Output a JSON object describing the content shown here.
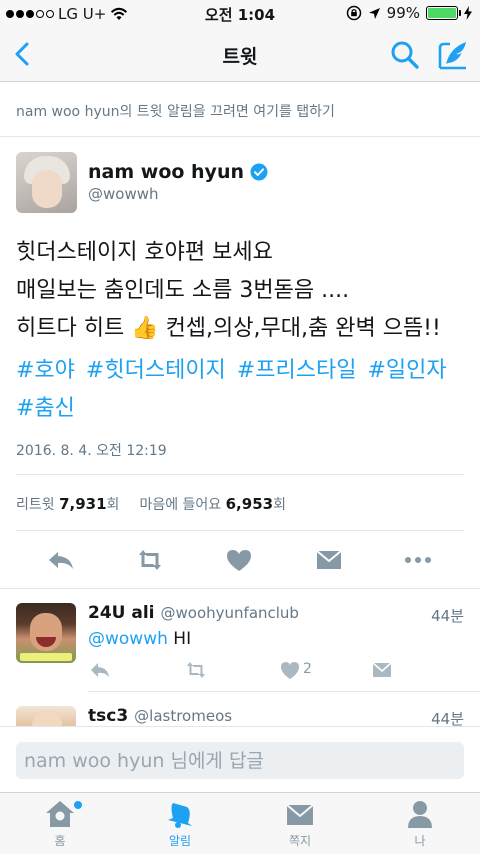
{
  "status_bar": {
    "carrier": "LG U+",
    "time": "오전 1:04",
    "battery": "99%",
    "battery_level": 0.99
  },
  "nav": {
    "title": "트윗",
    "icons": [
      "chevron-left-icon",
      "search-icon",
      "compose-icon"
    ]
  },
  "notify_bar": {
    "text": "nam woo hyun의 트윗 알림을 끄려면 여기를 탭하기"
  },
  "tweet": {
    "author_name": "nam woo hyun",
    "author_handle": "@wowwh",
    "verified": true,
    "text_lines": [
      "힛더스테이지 호야편 보세요",
      "매일보는 춤인데도 소름 3번돋음 ....",
      "히트다 히트 👍 컨셉,의상,무대,춤 완벽 으뜸!!"
    ],
    "hashtags": [
      "#호야",
      "#힛더스테이지",
      "#프리스타일",
      "#일인자",
      "#춤신"
    ],
    "timestamp": "2016. 8. 4. 오전 12:19",
    "retweet_label": "리트윗",
    "retweet_count": "7,931",
    "retweet_unit": "회",
    "like_label": "마음에 들어요",
    "like_count": "6,953",
    "like_unit": "회"
  },
  "replies": [
    {
      "name": "24U ali",
      "handle": "@woohyunfanclub",
      "time": "44분",
      "mention": "@wowwh",
      "text": "HI",
      "like_count": "2"
    },
    {
      "name": "tsc3",
      "handle": "@lastromeos",
      "time": "44분"
    }
  ],
  "reply_bar": {
    "placeholder": "nam woo hyun 님에게 답글"
  },
  "tabs": [
    {
      "label": "홈",
      "icon": "home-icon"
    },
    {
      "label": "알림",
      "icon": "bell-icon"
    },
    {
      "label": "쪽지",
      "icon": "envelope-icon"
    },
    {
      "label": "나",
      "icon": "person-icon"
    }
  ],
  "colors": {
    "accent": "#1da1f2",
    "muted": "#657786",
    "battery": "#4cd964"
  }
}
